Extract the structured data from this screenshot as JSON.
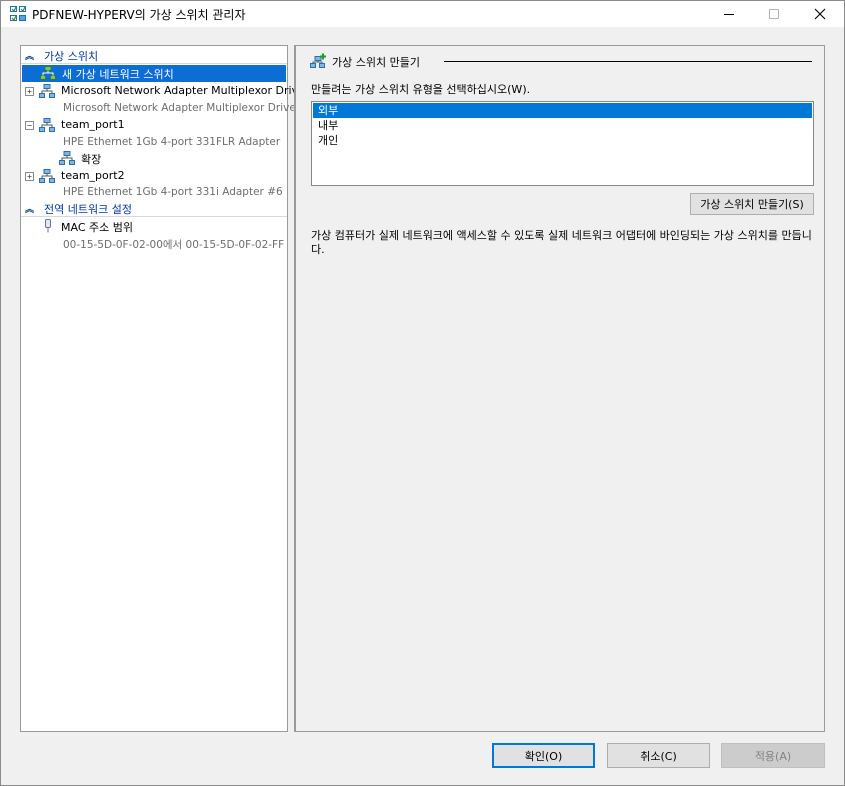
{
  "window": {
    "title": "PDFNEW-HYPERV의 가상 스위치 관리자",
    "minimize_glyph": "—",
    "close_glyph": "✕"
  },
  "tree": {
    "virtual_switches_header": "가상 스위치",
    "new_switch_label": "새 가상 네트워크 스위치",
    "switches": [
      {
        "name": "Microsoft Network Adapter Multiplexor Driv…",
        "adapter": "Microsoft Network Adapter Multiplexor Driver",
        "expander": "+"
      },
      {
        "name": "team_port1",
        "adapter": "HPE Ethernet 1Gb 4-port 331FLR Adapter",
        "expander": "−",
        "child": "확장"
      },
      {
        "name": "team_port2",
        "adapter": "HPE Ethernet 1Gb 4-port 331i Adapter #6",
        "expander": "+"
      }
    ],
    "global_settings_header": "전역 네트워크 설정",
    "mac_range_label": "MAC 주소 범위",
    "mac_range_value": "00-15-5D-0F-02-00에서 00-15-5D-0F-02-FF"
  },
  "right": {
    "group_title": "가상 스위치 만들기",
    "prompt": "만들려는 가상 스위치 유형을 선택하십시오(W).",
    "types": [
      "외부",
      "내부",
      "개인"
    ],
    "selected_type_index": 0,
    "create_button": "가상 스위치 만들기(S)",
    "description": "가상 컴퓨터가 실제 네트워크에 액세스할 수 있도록 실제 네트워크 어댑터에 바인딩되는 가상 스위치를 만듭니다."
  },
  "footer": {
    "ok": "확인(O)",
    "cancel": "취소(C)",
    "apply": "적용(A)"
  },
  "colors": {
    "selection": "#0c6ed4",
    "section_header": "#0037a6",
    "ok_border": "#0078d7",
    "disabled_text": "#838383"
  },
  "icons": {
    "app": "switch-manager-icon",
    "network": "network-switch-icon",
    "add_switch": "add-switch-icon",
    "mac": "mac-address-icon",
    "collapse": "chevron-up-double-icon"
  }
}
